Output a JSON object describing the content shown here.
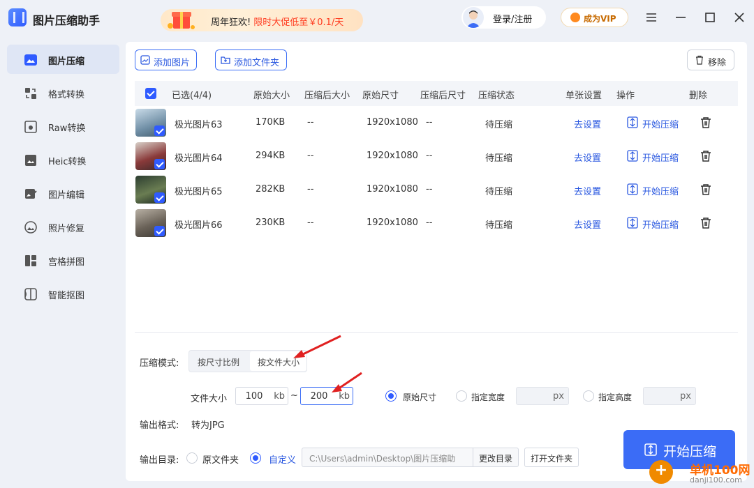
{
  "app": {
    "title": "图片压缩助手"
  },
  "promo": {
    "label": "周年狂欢!",
    "highlight": "限时大促低至￥0.1/天"
  },
  "header": {
    "login": "登录/注册",
    "vip": "成为VIP"
  },
  "sidebar": {
    "items": [
      {
        "label": "图片压缩",
        "icon": "image-compress-icon",
        "active": true
      },
      {
        "label": "格式转换",
        "icon": "format-convert-icon"
      },
      {
        "label": "Raw转换",
        "icon": "raw-convert-icon"
      },
      {
        "label": "Heic转换",
        "icon": "heic-convert-icon"
      },
      {
        "label": "图片编辑",
        "icon": "image-edit-icon"
      },
      {
        "label": "照片修复",
        "icon": "photo-repair-icon"
      },
      {
        "label": "宫格拼图",
        "icon": "grid-collage-icon"
      },
      {
        "label": "智能抠图",
        "icon": "smart-cutout-icon"
      }
    ]
  },
  "toolbar": {
    "add_image": "添加图片",
    "add_folder": "添加文件夹",
    "remove": "移除"
  },
  "table": {
    "headers": {
      "selected": "已选(4/4)",
      "orig_size": "原始大小",
      "comp_size": "压缩后大小",
      "orig_dim": "原始尺寸",
      "comp_dim": "压缩后尺寸",
      "status": "压缩状态",
      "settings": "单张设置",
      "action": "操作",
      "delete": "删除"
    },
    "rows": [
      {
        "name": "极光图片63",
        "orig_size": "170KB",
        "comp_size": "--",
        "orig_dim": "1920x1080",
        "comp_dim": "--",
        "status": "待压缩",
        "settings": "去设置",
        "action": "开始压缩"
      },
      {
        "name": "极光图片64",
        "orig_size": "294KB",
        "comp_size": "--",
        "orig_dim": "1920x1080",
        "comp_dim": "--",
        "status": "待压缩",
        "settings": "去设置",
        "action": "开始压缩"
      },
      {
        "name": "极光图片65",
        "orig_size": "282KB",
        "comp_size": "--",
        "orig_dim": "1920x1080",
        "comp_dim": "--",
        "status": "待压缩",
        "settings": "去设置",
        "action": "开始压缩"
      },
      {
        "name": "极光图片66",
        "orig_size": "230KB",
        "comp_size": "--",
        "orig_dim": "1920x1080",
        "comp_dim": "--",
        "status": "待压缩",
        "settings": "去设置",
        "action": "开始压缩"
      }
    ]
  },
  "settings": {
    "mode_label": "压缩模式:",
    "mode_options": [
      "按尺寸比例",
      "按文件大小"
    ],
    "mode_selected": "按文件大小",
    "file_size_label": "文件大小",
    "min_size": "100",
    "max_size": "200",
    "unit": "kb",
    "range_sep": "~",
    "dim_options": {
      "original": "原始尺寸",
      "width": "指定宽度",
      "height": "指定高度"
    },
    "dim_unit": "px",
    "output_format_label": "输出格式:",
    "output_format": "转为JPG",
    "output_dir_label": "输出目录:",
    "dir_original": "原文件夹",
    "dir_custom": "自定义",
    "dir_path": "C:\\Users\\admin\\Desktop\\图片压缩助",
    "change_dir": "更改目录",
    "open_folder": "打开文件夹"
  },
  "actions": {
    "start_all": "开始压缩"
  },
  "watermark": {
    "text": "单机100网",
    "sub": "danji100.com"
  },
  "colors": {
    "accent": "#3b6cf6",
    "highlight": "#ff3b1f",
    "arrow": "#e02020"
  }
}
